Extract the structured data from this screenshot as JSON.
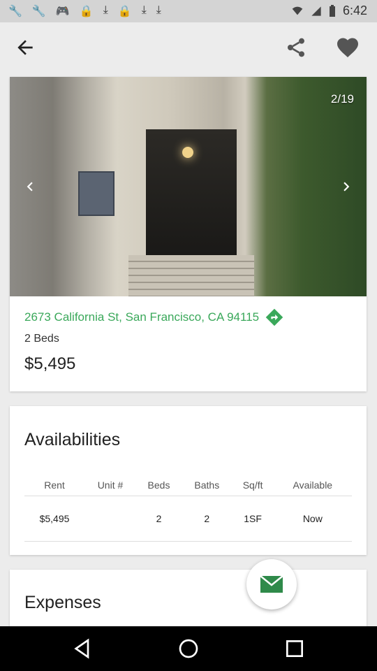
{
  "status_bar": {
    "left_icons": [
      "wrench-icon",
      "wrench-icon",
      "gamepad-icon",
      "lock-icon",
      "download-icon",
      "lock-icon",
      "download-icon",
      "download-icon"
    ],
    "right_icons": [
      "wifi-icon",
      "signal-icon",
      "battery-icon"
    ],
    "time": "6:42"
  },
  "app_bar": {
    "back_icon": "arrow-back-icon",
    "share_icon": "share-icon",
    "favorite_icon": "heart-icon"
  },
  "listing": {
    "photo_counter": "2/19",
    "address": "2673 California St, San Francisco, CA 94115",
    "beds": "2 Beds",
    "price": "$5,495"
  },
  "availabilities": {
    "title": "Availabilities",
    "columns": [
      "Rent",
      "Unit #",
      "Beds",
      "Baths",
      "Sq/ft",
      "Available"
    ],
    "rows": [
      [
        "$5,495",
        "",
        "2",
        "2",
        "1SF",
        "Now"
      ]
    ]
  },
  "expenses": {
    "title": "Expenses"
  },
  "colors": {
    "accent_green": "#3aa85a",
    "fab_icon": "#2f8a4a"
  }
}
